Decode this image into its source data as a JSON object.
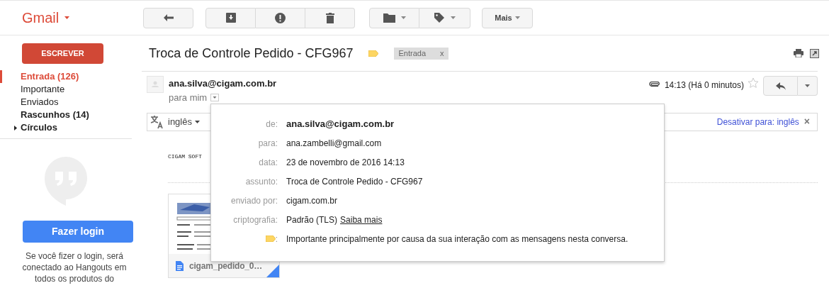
{
  "app": {
    "logo": "Gmail"
  },
  "toolbar": {
    "more_button": "Mais"
  },
  "sidebar": {
    "compose_button": "ESCREVER",
    "items": [
      {
        "label": "Entrada (126)",
        "selected": true,
        "bold": true,
        "expandable": false
      },
      {
        "label": "Importante",
        "selected": false,
        "bold": false,
        "expandable": false
      },
      {
        "label": "Enviados",
        "selected": false,
        "bold": false,
        "expandable": false
      },
      {
        "label": "Rascunhos (14)",
        "selected": false,
        "bold": true,
        "expandable": false
      },
      {
        "label": "Círculos",
        "selected": false,
        "bold": true,
        "expandable": true
      }
    ],
    "hangouts": {
      "login_button": "Fazer login",
      "message": "Se você fizer o login, será conectado ao Hangouts em todos os produtos do"
    }
  },
  "message": {
    "subject": "Troca de Controle Pedido - CFG967",
    "important": true,
    "label_chip": "Entrada",
    "label_remove": "x",
    "sender": "ana.silva@cigam.com.br",
    "recipient_summary": "para mim",
    "has_attachment": true,
    "time": "14:13 (Há 0 minutos)",
    "starred": false,
    "translate_bar": {
      "language": "inglês",
      "disable_link": "Desativar para: inglês",
      "close": "×"
    },
    "body_text": "CIGAM SOFT",
    "attachment": {
      "filename": "cigam_pedido_0…"
    }
  },
  "details_popup": {
    "rows": [
      {
        "kind": "sender",
        "label": "de:",
        "value": "ana.silva@cigam.com.br"
      },
      {
        "kind": "field",
        "label": "para:",
        "value": "ana.zambelli@gmail.com"
      },
      {
        "kind": "field",
        "label": "data:",
        "value": "23 de novembro de 2016 14:13"
      },
      {
        "kind": "field",
        "label": "assunto:",
        "value": "Troca de Controle Pedido - CFG967"
      },
      {
        "kind": "field",
        "label": "enviado por:",
        "value": "cigam.com.br"
      },
      {
        "kind": "link",
        "label": "criptografia:",
        "value": "Padrão (TLS)",
        "link": "Saiba mais"
      },
      {
        "kind": "importance",
        "label": ":",
        "value": "Importante principalmente por causa da sua interação com as mensagens nesta conversa."
      }
    ]
  }
}
